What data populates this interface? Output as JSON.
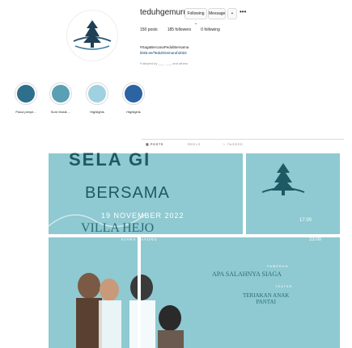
{
  "profile": {
    "username": "teduhgemuruh",
    "following_btn": "Following ⌄",
    "message_btn": "Message",
    "add_btn": "+",
    "more": "•••",
    "posts": "150 posts",
    "followers": "185 followers",
    "following": "0 following",
    "bio_line1": "#SagaBercanaPeduliBersama",
    "bio_line2": "linktr.ee/TeduhGemuruh2022",
    "follow_note": "Followed by ___ , ___ and others"
  },
  "highlights": [
    {
      "label": "Pukul penye...",
      "color": "#2e6f8c"
    },
    {
      "label": "Sore Musik ...",
      "color": "#5aa0b5"
    },
    {
      "label": "Highlights",
      "color": "#9fd1e0"
    },
    {
      "label": "Highlights",
      "color": "#2b63a3"
    }
  ],
  "tabs": {
    "posts": "▦ POSTS",
    "reels": "REELS",
    "tagged": "☆ TAGGED"
  },
  "post1": {
    "sela": "SELA GI",
    "bersama": "BERSAMA",
    "date": "19 NOVEMBER 2022",
    "venue": "VILLA HEJO",
    "time": "17.00"
  },
  "post2": {
    "kiara": "KIARA PAYUNG",
    "time": "23.00",
    "pameran": "PAMERAN",
    "salahnya": "APA SALAHNYA SIAGA",
    "teater": "TEATER",
    "teriakan_line1": "TERIAKAN ANAK",
    "teriakan_line2": "PANTAI"
  },
  "colors": {
    "post_bg": "#8fc9d1",
    "accent": "#1d5a63"
  }
}
